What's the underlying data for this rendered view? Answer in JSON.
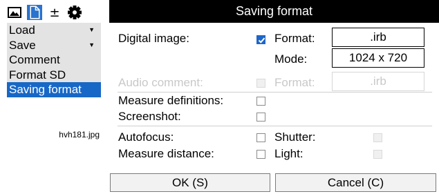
{
  "toolbar": {
    "icons": [
      "image-icon",
      "file-icon",
      "plus-minus-icon",
      "gear-icon"
    ],
    "plus_minus_glyph": "±"
  },
  "menu": {
    "items": [
      {
        "label": "Load",
        "has_arrow": true
      },
      {
        "label": "Save",
        "has_arrow": true
      },
      {
        "label": "Comment",
        "has_arrow": false
      },
      {
        "label": "Format SD",
        "has_arrow": false
      },
      {
        "label": "Saving format",
        "has_arrow": false
      }
    ],
    "selected_index": 4,
    "arrow_glyph": "▼"
  },
  "filename": "hvh181.jpg",
  "dialog": {
    "title": "Saving format",
    "digital_image": {
      "label": "Digital image:",
      "checked": true,
      "format_label": "Format:",
      "format_value": ".irb",
      "mode_label": "Mode:",
      "mode_value": "1024 x 720"
    },
    "audio_comment": {
      "label": "Audio comment:",
      "checked": false,
      "disabled": true,
      "format_label": "Format:",
      "format_value": ".irb"
    },
    "measure_definitions": {
      "label": "Measure definitions:",
      "checked": false
    },
    "screenshot": {
      "label": "Screenshot:",
      "checked": false
    },
    "autofocus": {
      "label": "Autofocus:",
      "checked": false
    },
    "shutter": {
      "label": "Shutter:",
      "checked": false,
      "disabled": true
    },
    "measure_distance": {
      "label": "Measure distance:",
      "checked": false
    },
    "light": {
      "label": "Light:",
      "checked": false,
      "disabled": true
    },
    "ok_label": "OK (S)",
    "cancel_label": "Cancel (C)"
  },
  "colors": {
    "title_bg": "#000000",
    "selected_bg": "#1767c7",
    "menu_bg": "#e3e3e3",
    "check_blue": "#1e66c9",
    "toolbar_active": "#2a73ce"
  }
}
